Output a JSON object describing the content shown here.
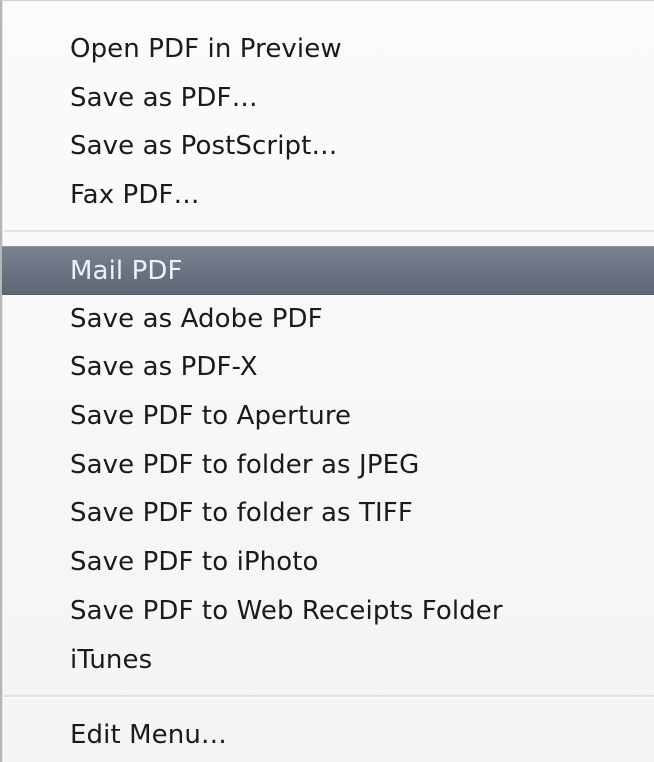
{
  "menu": {
    "groups": [
      {
        "items": [
          {
            "label": "Open PDF in Preview"
          },
          {
            "label": "Save as PDF…"
          },
          {
            "label": "Save as PostScript…"
          },
          {
            "label": "Fax PDF…"
          }
        ]
      },
      {
        "items": [
          {
            "label": "Mail PDF",
            "selected": true
          },
          {
            "label": "Save as Adobe PDF"
          },
          {
            "label": "Save as PDF-X"
          },
          {
            "label": "Save PDF to Aperture"
          },
          {
            "label": "Save PDF to folder as JPEG"
          },
          {
            "label": "Save PDF to folder as TIFF"
          },
          {
            "label": "Save PDF to iPhoto"
          },
          {
            "label": "Save PDF to Web Receipts Folder"
          },
          {
            "label": "iTunes"
          }
        ]
      },
      {
        "items": [
          {
            "label": "Edit Menu…"
          }
        ]
      }
    ],
    "colors": {
      "highlight": "#6a7180",
      "highlight_text": "#eef1f6",
      "text": "#1a1a1a",
      "background": "#f8f8f8"
    }
  }
}
